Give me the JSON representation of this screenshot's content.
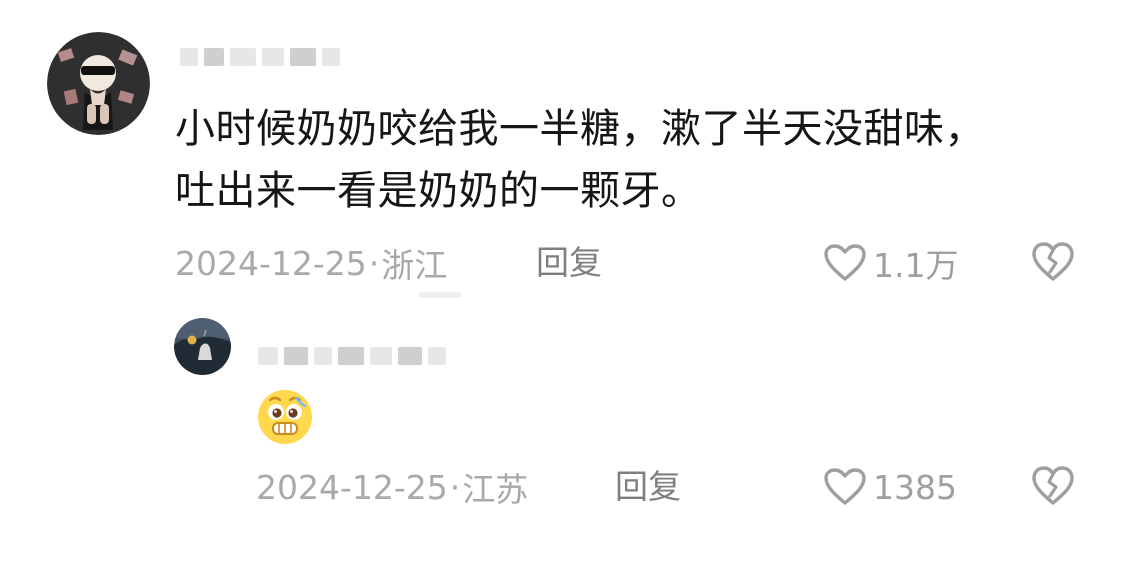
{
  "comments": [
    {
      "text_line1": "小时候奶奶咬给我一半糖，漱了半天没甜味，",
      "text_line2": "吐出来一看是奶奶的一颗牙。",
      "date": "2024-12-25",
      "separator": "·",
      "location": "浙江",
      "reply_label": "回复",
      "likes": "1.1万",
      "avatar_icon": "avatar-main-icon",
      "like_icon": "heart-outline-icon",
      "dislike_icon": "broken-heart-icon"
    },
    {
      "emoji_icon": "pleading-face-icon",
      "date": "2024-12-25",
      "separator": "·",
      "location": "江苏",
      "reply_label": "回复",
      "likes": "1385",
      "avatar_icon": "avatar-reply-icon",
      "like_icon": "heart-outline-icon",
      "dislike_icon": "broken-heart-icon"
    }
  ],
  "colors": {
    "text_primary": "#161616",
    "text_meta": "#a9a9a9",
    "text_action": "#7f7f7f",
    "icon_gray": "#9f9f9f",
    "emoji_yellow": "#ffd84d"
  }
}
